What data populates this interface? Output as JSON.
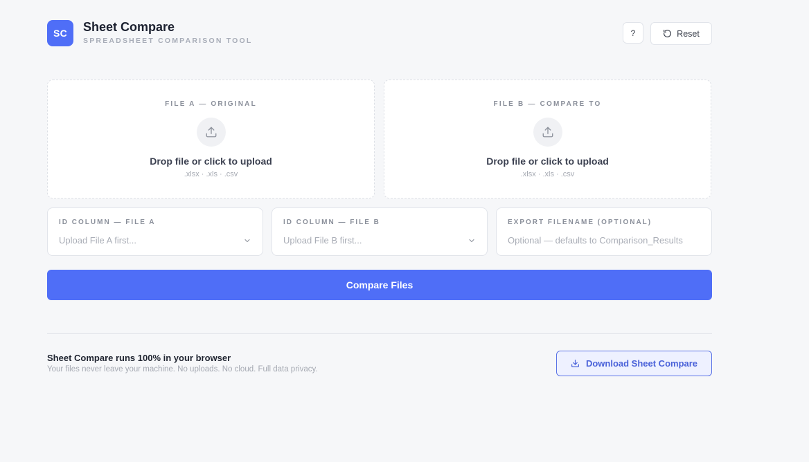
{
  "header": {
    "logo_text": "SC",
    "title": "Sheet Compare",
    "subtitle": "SPREADSHEET COMPARISON TOOL",
    "help_label": "?",
    "reset_label": "Reset"
  },
  "uploads": [
    {
      "label": "FILE A — ORIGINAL",
      "prompt": "Drop file or click to upload",
      "hint": ".xlsx · .xls · .csv"
    },
    {
      "label": "FILE B — COMPARE TO",
      "prompt": "Drop file or click to upload",
      "hint": ".xlsx · .xls · .csv"
    }
  ],
  "fields": {
    "id_column_a": {
      "label": "ID COLUMN — FILE A",
      "placeholder": "Upload File A first..."
    },
    "id_column_b": {
      "label": "ID COLUMN — FILE B",
      "placeholder": "Upload File B first..."
    },
    "export_filename": {
      "label": "EXPORT FILENAME (OPTIONAL)",
      "placeholder": "Optional — defaults to Comparison_Results"
    }
  },
  "compare_label": "Compare Files",
  "footer": {
    "title": "Sheet Compare runs 100% in your browser",
    "subtitle": "Your files never leave your machine. No uploads. No cloud. Full data privacy.",
    "download_label": "Download Sheet Compare"
  },
  "colors": {
    "accent": "#4f6ef7",
    "background": "#f6f7f9",
    "download_text": "#4a62d9"
  },
  "icons": {
    "reset": "rotate-ccw-icon",
    "upload": "upload-icon",
    "dropdown": "chevron-down-icon",
    "download": "download-icon"
  }
}
